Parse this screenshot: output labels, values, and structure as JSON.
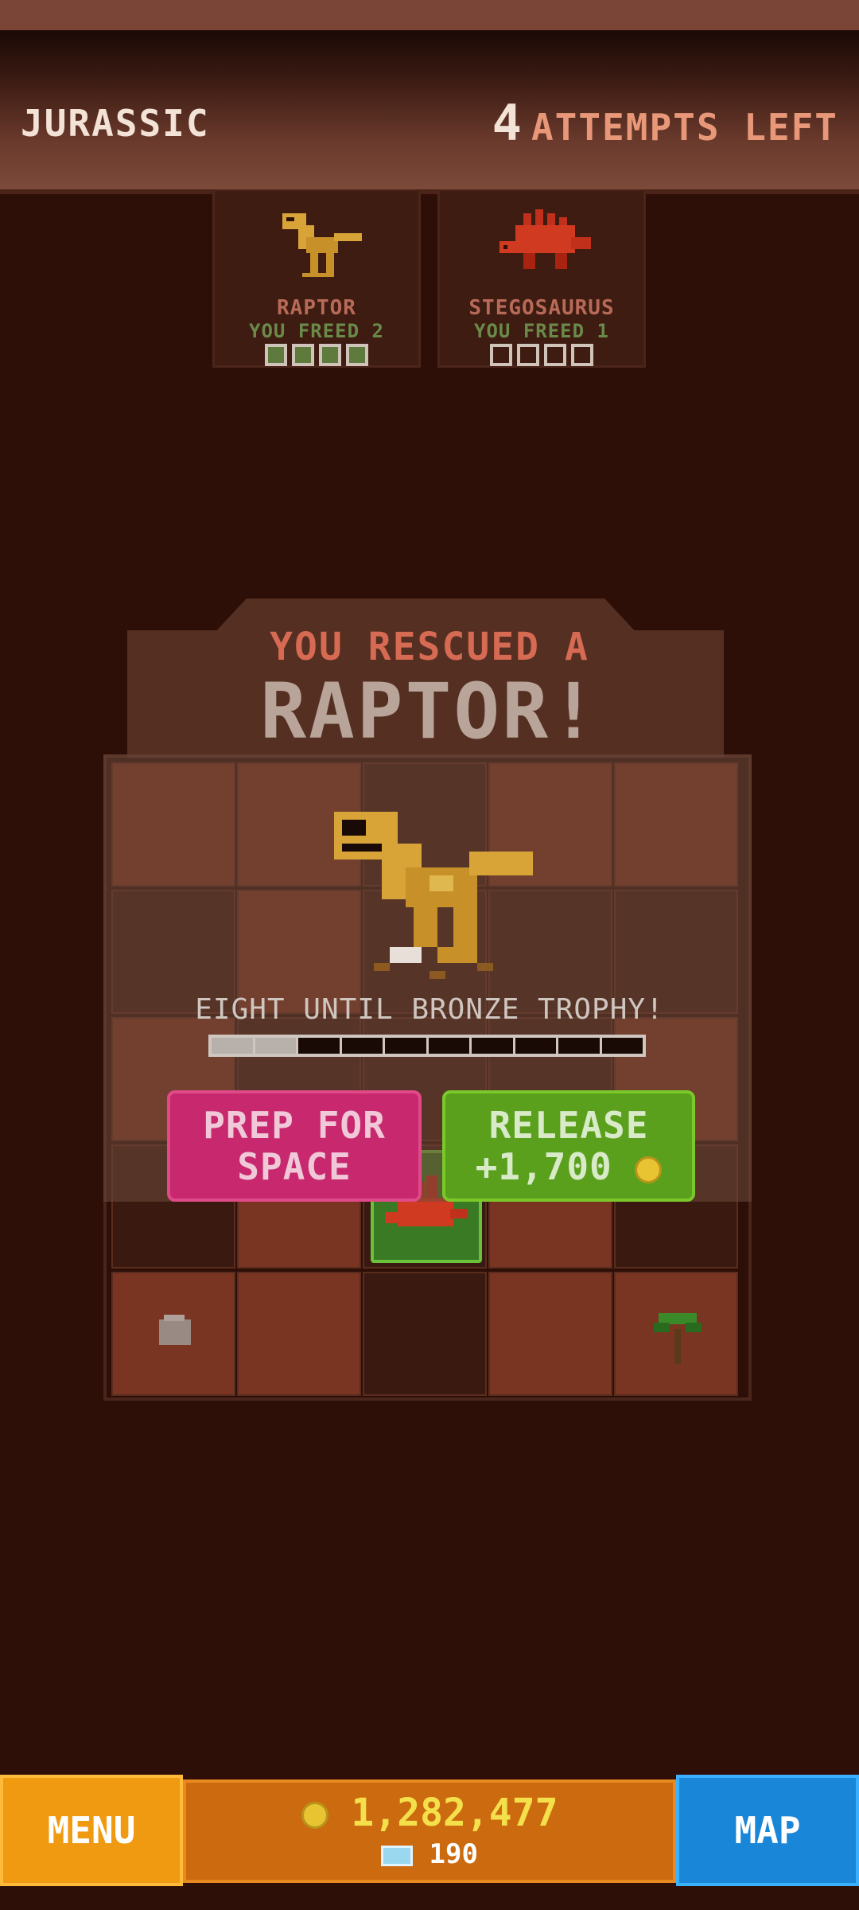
{
  "header": {
    "era": "JURASSIC",
    "attempts_count": "4",
    "attempts_label": "ATTEMPTS LEFT"
  },
  "dino_cards": [
    {
      "name": "RAPTOR",
      "freed": "YOU FREED 2",
      "pips_filled": 4,
      "color": "#d8a438"
    },
    {
      "name": "STEGOSAURUS",
      "freed": "YOU FREED 1",
      "pips_filled": 0,
      "color": "#c0301a"
    }
  ],
  "dialog": {
    "subtitle": "YOU RESCUED A",
    "title": "RAPTOR!",
    "trophy_text": "EIGHT UNTIL BRONZE TROPHY!",
    "trophy_progress": 0.2,
    "prep_line1": "PREP FOR",
    "prep_line2": "SPACE",
    "release_line1": "RELEASE",
    "release_reward": "+1,700"
  },
  "bottom": {
    "menu_label": "MENU",
    "coins": "1,282,477",
    "gems": "190",
    "map_label": "MAP"
  },
  "colors": {
    "prep": "#c8286e",
    "release": "#5aa01c",
    "menu": "#f09a12",
    "map": "#1a86d8"
  }
}
